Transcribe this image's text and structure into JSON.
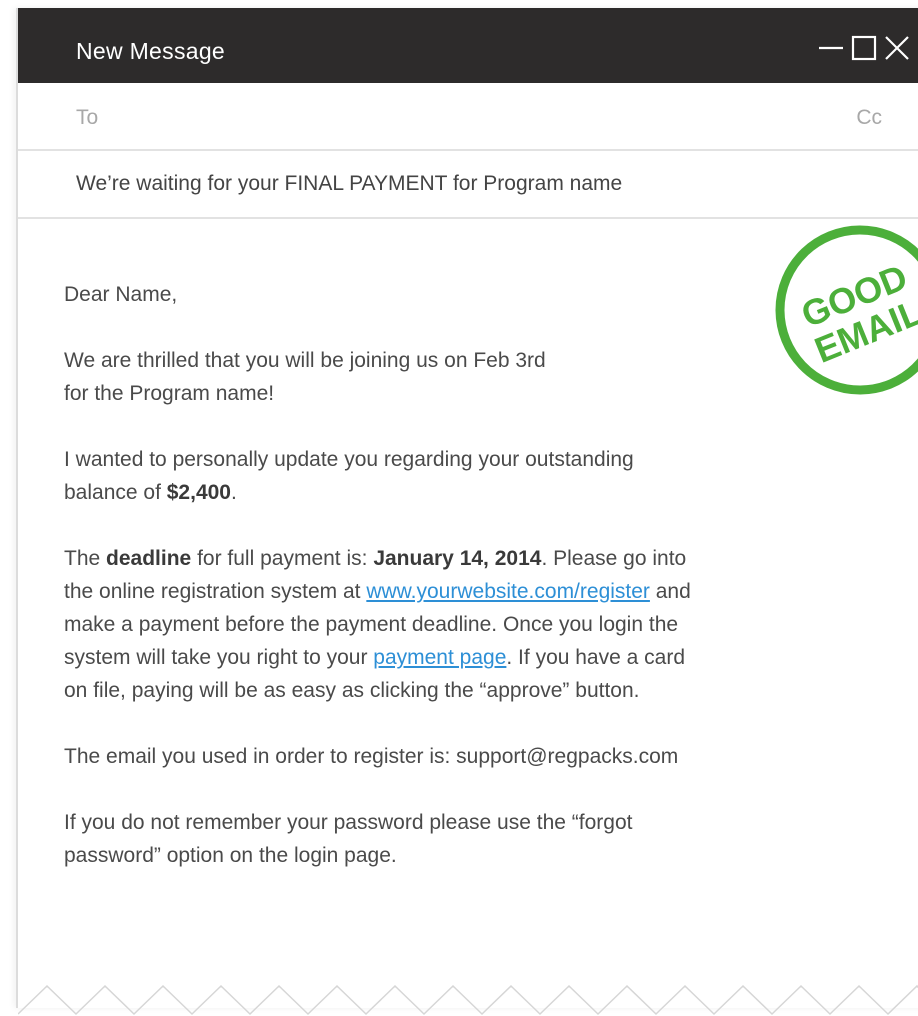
{
  "window": {
    "title": "New Message",
    "controls": [
      "minimize-icon",
      "maximize-icon",
      "close-icon"
    ],
    "titlebar_color": "#2d2b2b"
  },
  "compose": {
    "to_label": "To",
    "cc_label": "Cc",
    "subject": "We’re waiting for your FINAL PAYMENT for Program name"
  },
  "stamp": {
    "line1": "GOOD",
    "line2": "EMAIL",
    "color": "#4caf3a"
  },
  "body": {
    "greeting": "Dear Name,",
    "p1_line1": "We are thrilled that you will be joining us on Feb 3rd",
    "p1_line2": "for the Program name!",
    "p2_line1": "I wanted to personally update you regarding your outstanding",
    "p2_pre": "balance of ",
    "p2_amount": "$2,400",
    "p2_post": ".",
    "p3_t1": "The ",
    "p3_deadline": "deadline",
    "p3_t2": " for full payment is: ",
    "p3_date": "January 14, 2014",
    "p3_t3": ". Please go into",
    "p3_t4": "the online registration system at ",
    "p3_link1": "www.yourwebsite.com/register",
    "p3_t5": " and",
    "p3_t6": "make a payment before the payment deadline. Once you login the",
    "p3_t7": "system will take you right to your ",
    "p3_link2": "payment page",
    "p3_t8": ". If you have a card",
    "p3_t9": "on file, paying will be as easy as clicking the “approve” button.",
    "p4": "The email you used in order to register is: support@regpacks.com",
    "p5_line1": "If you do not remember your password please use the “forgot",
    "p5_line2": "password” option on the login page."
  },
  "colors": {
    "link": "#2d8fd6",
    "text": "#4a4a4a"
  }
}
